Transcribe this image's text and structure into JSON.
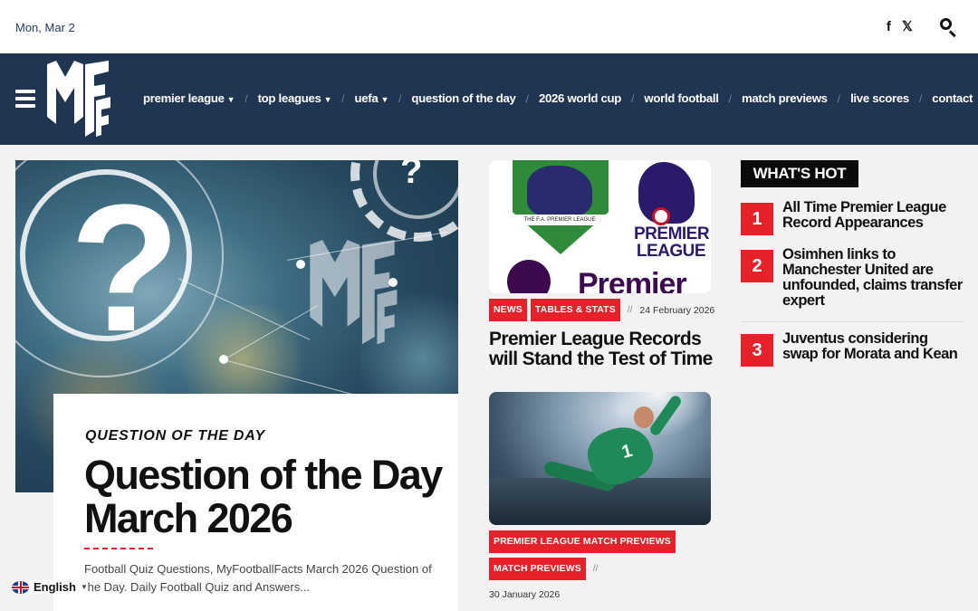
{
  "topbar": {
    "date": "Mon, Mar 2",
    "icons": [
      "facebook-icon",
      "x-icon",
      "search-icon"
    ]
  },
  "nav": {
    "logo_text": "MFF",
    "items": [
      {
        "label": "premier league",
        "dropdown": true
      },
      {
        "label": "top leagues",
        "dropdown": true
      },
      {
        "label": "uefa",
        "dropdown": true
      },
      {
        "label": "question of the day",
        "dropdown": false
      },
      {
        "label": "2026 world cup",
        "dropdown": false
      },
      {
        "label": "world football",
        "dropdown": false
      },
      {
        "label": "match previews",
        "dropdown": false
      },
      {
        "label": "live scores",
        "dropdown": false
      },
      {
        "label": "contact",
        "dropdown": false
      }
    ]
  },
  "hero": {
    "category": "QUESTION OF THE DAY",
    "title": "Question of the Day March 2026",
    "excerpt": "Football Quiz Questions, MyFootballFacts March 2026 Question of the Day. Daily Football Quiz and Answers..."
  },
  "language": {
    "label": "English"
  },
  "middle": {
    "post1": {
      "tags": [
        "NEWS",
        "TABLES & STATS"
      ],
      "separator": "//",
      "date": "24 February 2026",
      "title": "Premier League Records will Stand the Test of Time",
      "image_text": {
        "ribbon": "THE F.A. PREMIER LEAGUE",
        "word": "PREMIER LEAGUE",
        "bottom_word": "Premier"
      }
    },
    "post2": {
      "tags": [
        "PREMIER LEAGUE MATCH PREVIEWS",
        "MATCH PREVIEWS"
      ],
      "separator": "//",
      "date": "30 January 2026",
      "image_number": "1"
    }
  },
  "whats_hot": {
    "heading": "WHAT'S HOT",
    "items": [
      {
        "rank": "1",
        "title": "All Time Premier League Record Appearances"
      },
      {
        "rank": "2",
        "title": "Osimhen links to Manchester United are unfounded, claims transfer expert"
      },
      {
        "rank": "3",
        "title": "Juventus considering swap for Morata and Kean"
      }
    ]
  },
  "colors": {
    "nav_bg": "#1f3552",
    "accent_red": "#e62129",
    "date_text": "#1f3a5c"
  }
}
